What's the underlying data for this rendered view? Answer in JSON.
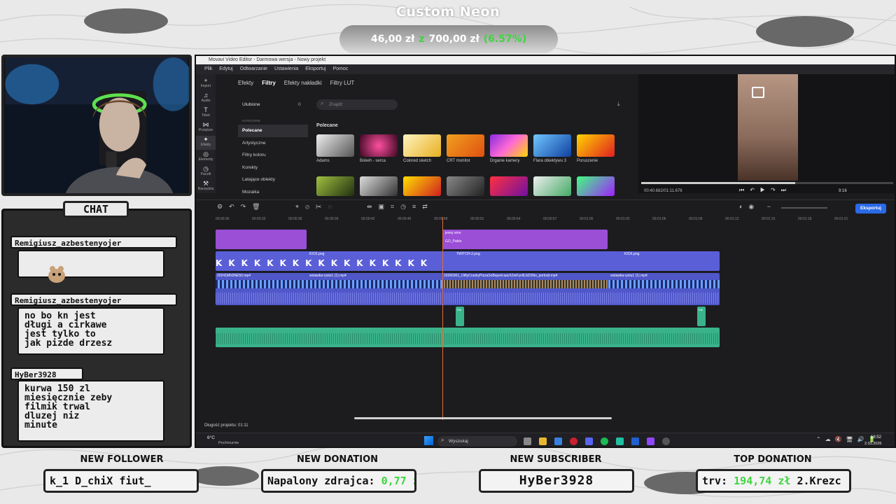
{
  "goal": {
    "title": "Custom Neon",
    "current": "46,00 zł",
    "sep": "z",
    "target": "700,00 zł",
    "percent": "(6.57%)"
  },
  "chat": {
    "header": "CHAT",
    "messages": [
      {
        "user": "Remigiusz_azbestenyojer",
        "text": ""
      },
      {
        "user": "Remigiusz_azbestenyojer",
        "text": "no bo kn jest\ndługi a cirkawe\njest tylko to\njak pizde drzesz"
      },
      {
        "user": "HyBer3928",
        "text": "kurwa 150 zl\nmiesięcznie zeby\nfilmik trwal\ndluzej niz\nminute"
      }
    ]
  },
  "bottom": {
    "follower": {
      "label": "NEW FOLLOWER",
      "value": "k_1   D_chiX   fiut_"
    },
    "donation": {
      "label": "NEW DONATION",
      "name": "Napalony zdrajca:",
      "amount": "0,77 zł"
    },
    "subscriber": {
      "label": "NEW SUBSCRIBER",
      "value": "HyBer3928"
    },
    "top": {
      "label": "TOP DONATION",
      "prefix": "trv:",
      "amount": "194,74 zł",
      "suffix": "2.Krezc"
    }
  },
  "editor": {
    "window_title": "Movavi Video Editor - Darmowa wersja - Nowy projekt",
    "menu": [
      "Plik",
      "Edytuj",
      "Odtwarzanie",
      "Ustawienia",
      "Eksportuj",
      "Pomoc"
    ],
    "tools": [
      {
        "label": "Import",
        "icon": "plus-icon"
      },
      {
        "label": "Audio",
        "icon": "music-icon"
      },
      {
        "label": "Tekst",
        "icon": "text-icon"
      },
      {
        "label": "Przejście",
        "icon": "transition-icon"
      },
      {
        "label": "Efekty",
        "icon": "sparkle-icon"
      },
      {
        "label": "Elementy",
        "icon": "elements-icon"
      },
      {
        "label": "Pacziti",
        "icon": "clock-icon"
      },
      {
        "label": "Narzędzia",
        "icon": "tools-icon"
      }
    ],
    "tabs": [
      "Efekty",
      "Filtry",
      "Efekty nakładki",
      "Filtry LUT"
    ],
    "active_tab": "Filtry",
    "favorites": "Ulubione",
    "favorites_count": "0",
    "categories_header": "KATEGORIE",
    "categories": [
      "Polecane",
      "Artystyczne",
      "Filtry koloru",
      "Korekty",
      "Latające obiekty",
      "Mozaika"
    ],
    "selected_category": "Polecane",
    "search_placeholder": "Znajdź",
    "section": "Polecane",
    "filters": [
      "Adams",
      "Bokeh - serca",
      "Colored sketch",
      "CRT monitor",
      "Drganie kamery",
      "Flara obiektywu 3",
      "Poruszenie"
    ],
    "preview_time": "00:40.682/01:11.676",
    "preview_counter": "9:16",
    "export_label": "Eksportuj",
    "ruler": [
      "00:00:36",
      "00:00:33",
      "00:00:36",
      "00:00:39",
      "00:00:42",
      "00:00:45",
      "00:00:48",
      "00:00:51",
      "00:00:54",
      "00:00:57",
      "00:01:00",
      "00:01:03",
      "00:01:06",
      "00:01:09",
      "00:01:12",
      "00:01:15",
      "00:01:18",
      "00:01:21"
    ],
    "clips": {
      "title1": "jesny smo",
      "title2": "GO_Pablo",
      "img1": "KICK.png",
      "img2": "TWITCH-2.png",
      "img3": "KICK.png",
      "vid1": "20241MN3NE50.mp4",
      "vid2": "wstawka-ryslu1 (1).mp4",
      "vid3": "20260301_OiftyCrunkyPizzaSoBayed-aavXZwFyv9LbDSNx_portrait.mp4",
      "vid4": "wstawka-ryslu1 (1).mp4",
      "sfx1": "Efe",
      "sfx2": "Efe"
    },
    "duration": "Długość projektu: 01:11",
    "taskbar": {
      "weather_temp": "6°C",
      "weather_desc": "Pochmurnie",
      "search": "Wyszukaj",
      "time": "18:52",
      "date": "2.03.2026"
    }
  }
}
